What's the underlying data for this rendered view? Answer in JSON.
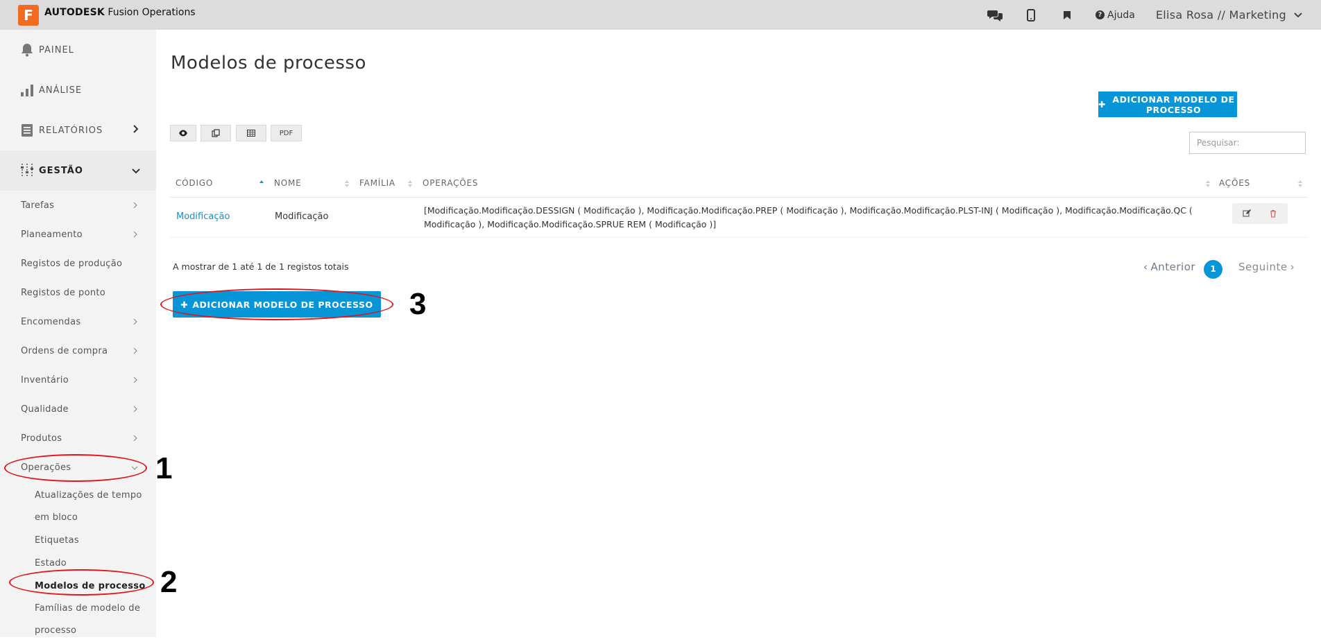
{
  "app": {
    "logo_letter": "F",
    "brand_bold": "AUTODESK",
    "brand_rest": "Fusion Operations"
  },
  "topbar": {
    "icons": [
      "chat-icon",
      "mobile-icon",
      "bookmark-icon"
    ],
    "help_label": "Ajuda",
    "user_label": "Elisa Rosa // Marketing"
  },
  "sidebar": {
    "main": [
      {
        "label": "PAINEL",
        "icon": "bell-icon"
      },
      {
        "label": "ANÁLISE",
        "icon": "bar-chart-icon"
      },
      {
        "label": "RELATÓRIOS",
        "icon": "document-icon"
      },
      {
        "label": "GESTÃO",
        "icon": "sliders-icon"
      }
    ],
    "sub": [
      "Tarefas",
      "Planeamento",
      "Registos de produção",
      "Registos de ponto",
      "Encomendas",
      "Ordens de compra",
      "Inventário",
      "Qualidade",
      "Produtos",
      "Operações"
    ],
    "operacoes_children": [
      "Atualizações de tempo em bloco",
      "Etiquetas",
      "Estado",
      "Modelos de processo",
      "Famílias de modelo de processo"
    ]
  },
  "main": {
    "title": "Modelos de processo",
    "add_button_label": "ADICIONAR MODELO DE PROCESSO",
    "toolbar": {
      "pdf_label": "PDF"
    },
    "search_placeholder": "Pesquisar:",
    "table": {
      "headers": [
        "CÓDIGO",
        "NOME",
        "FAMÍLIA",
        "OPERAÇÕES",
        "AÇÕES"
      ],
      "rows": [
        {
          "codigo": "Modificação",
          "nome": "Modificação",
          "familia": "",
          "operacoes": "[Modificação.Modificação.DESSIGN ( Modificação ), Modificação.Modificação.PREP ( Modificação ), Modificação.Modificação.PLST-INJ ( Modificação ), Modificação.Modificação.QC ( Modificação ), Modificação.Modificação.SPRUE REM ( Modificação )]"
        }
      ]
    },
    "info_text": "A mostrar de 1 até 1 de 1 registos totais",
    "pagination": {
      "prev": "Anterior",
      "current": "1",
      "next": "Seguinte"
    }
  },
  "annotations": {
    "one": "1",
    "two": "2",
    "three": "3"
  },
  "colors": {
    "accent": "#0696d7",
    "brand": "#f26b21",
    "callout": "#e1141b"
  }
}
